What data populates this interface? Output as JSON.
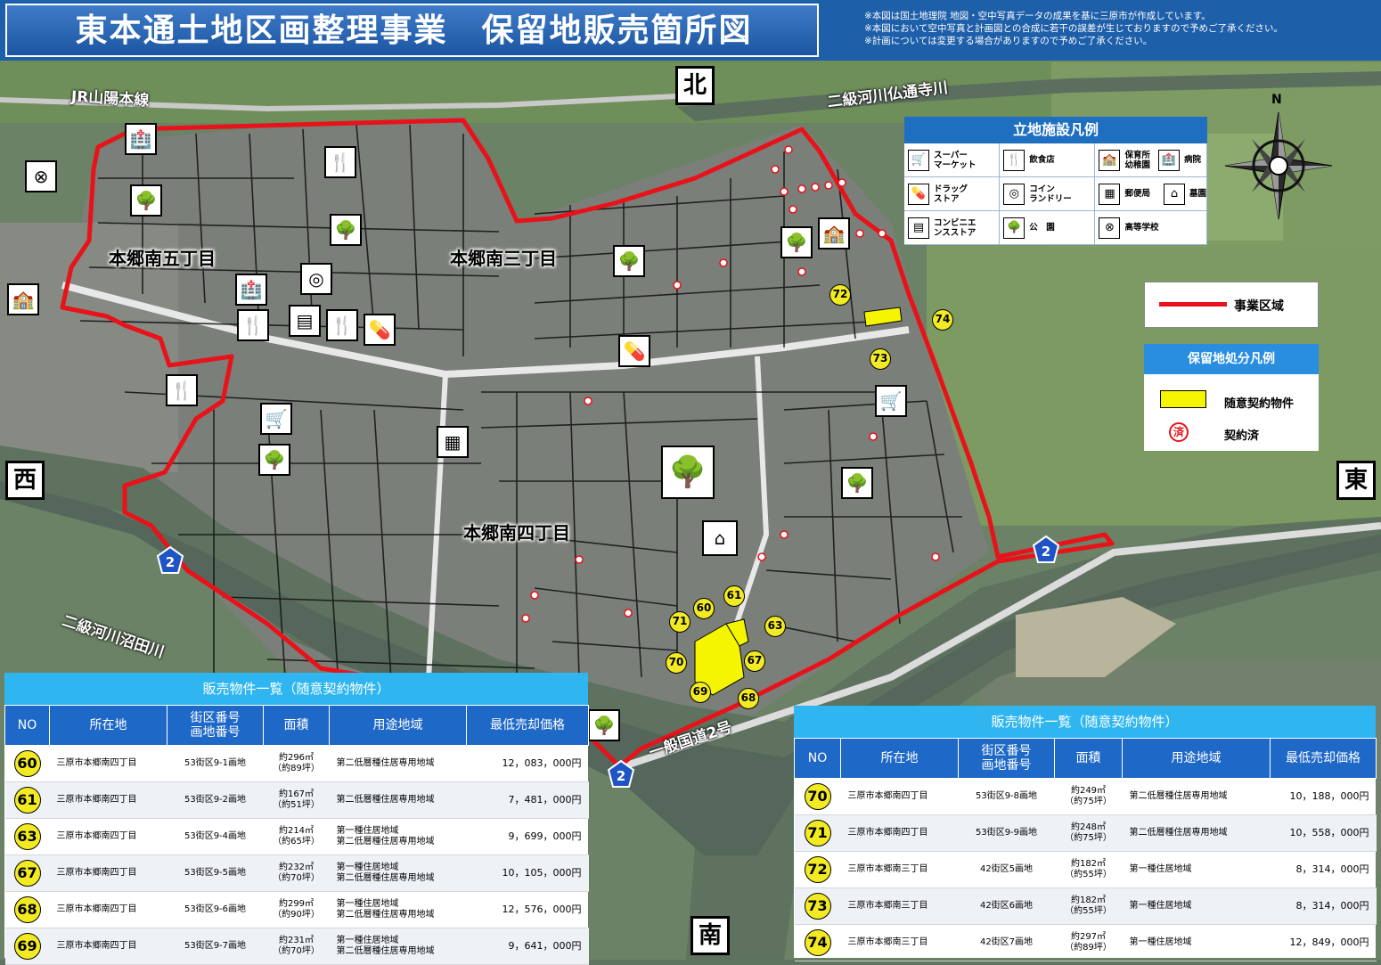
{
  "header": {
    "title": "東本通土地区画整理事業　保留地販売箇所図",
    "notes": [
      "※本図は国土地理院 地図・空中写真データの成果を基に三原市が作成しています。",
      "※本図において空中写真と計画図との合成に若干の誤差が生じておりますので予めご了承ください。",
      "※計画については変更する場合がありますので予めご了承ください。"
    ]
  },
  "directions": {
    "north": "北",
    "south": "南",
    "east": "東",
    "west": "西"
  },
  "compass": {
    "north_letter": "N"
  },
  "map_labels": {
    "districts": [
      "本郷南五丁目",
      "本郷南三丁目",
      "本郷南四丁目"
    ],
    "rail": "JR山陽本線",
    "river_north": "二級河川仏通寺川",
    "river_south": "二級河川沼田川",
    "highway": "一般国道2号",
    "route_number": "2"
  },
  "facility_icons": [
    "park-icon",
    "school-icon",
    "store-icon",
    "restaurant-icon",
    "laundry-icon",
    "hospital-icon",
    "drugstore-icon",
    "supermarket-icon",
    "convenience-icon",
    "cemetery-icon",
    "highschool-icon"
  ],
  "lots_on_map": [
    "72",
    "74",
    "73",
    "61",
    "60",
    "71",
    "63",
    "70",
    "67",
    "69",
    "68"
  ],
  "legend_facilities": {
    "title": "立地施設凡例",
    "items": [
      {
        "icon": "supermarket-icon",
        "label": "スーパー\nマーケット"
      },
      {
        "icon": "restaurant-icon",
        "label": "飲食店"
      },
      {
        "icon": "nursery-icon",
        "label": "保育所\n幼稚園"
      },
      {
        "icon": "hospital-icon",
        "label": "病院"
      },
      {
        "icon": "drugstore-icon",
        "label": "ドラッグ\nストア"
      },
      {
        "icon": "laundry-icon",
        "label": "コイン\nランドリー"
      },
      {
        "icon": "post-office-icon",
        "label": "郵便局"
      },
      {
        "icon": "cemetery-icon",
        "label": "墓園"
      },
      {
        "icon": "convenience-store-icon",
        "label": "コンビニエ\nンスストア"
      },
      {
        "icon": "park-icon",
        "label": "公　園"
      },
      {
        "icon": "highschool-icon",
        "label": "高等学校"
      }
    ]
  },
  "legend_area": {
    "label": "事業区域",
    "color": "#e8121a"
  },
  "legend_lots": {
    "title": "保留地処分凡例",
    "negotiated_label": "随意契約物件",
    "contracted_label": "契約済",
    "contracted_mark": "済",
    "negotiated_color": "#f5f500"
  },
  "table_columns": {
    "no": "NO",
    "location": "所在地",
    "block": "街区番号\n画地番号",
    "area": "面積",
    "zoning": "用途地域",
    "price": "最低売却価格"
  },
  "table_left": {
    "title": "販売物件一覧（随意契約物件）",
    "rows": [
      {
        "no": "60",
        "location": "三原市本郷南四丁目",
        "block": "53街区9-1画地",
        "area": "約296㎡\n（約89坪）",
        "zoning": "第二低層種住居専用地域",
        "price": "12，083，000円"
      },
      {
        "no": "61",
        "location": "三原市本郷南四丁目",
        "block": "53街区9-2画地",
        "area": "約167㎡\n（約51坪）",
        "zoning": "第二低層種住居専用地域",
        "price": "7，481，000円"
      },
      {
        "no": "63",
        "location": "三原市本郷南四丁目",
        "block": "53街区9-4画地",
        "area": "約214㎡\n（約65坪）",
        "zoning": "第一種住居地域\n第二低層種住居専用地域",
        "price": "9，699，000円"
      },
      {
        "no": "67",
        "location": "三原市本郷南四丁目",
        "block": "53街区9-5画地",
        "area": "約232㎡\n（約70坪）",
        "zoning": "第一種住居地域\n第二低層種住居専用地域",
        "price": "10，105，000円"
      },
      {
        "no": "68",
        "location": "三原市本郷南四丁目",
        "block": "53街区9-6画地",
        "area": "約299㎡\n（約90坪）",
        "zoning": "第一種住居地域\n第二低層種住居専用地域",
        "price": "12，576，000円"
      },
      {
        "no": "69",
        "location": "三原市本郷南四丁目",
        "block": "53街区9-7画地",
        "area": "約231㎡\n（約70坪）",
        "zoning": "第一種住居地域\n第二低層種住居専用地域",
        "price": "9，641，000円"
      }
    ]
  },
  "table_right": {
    "title": "販売物件一覧（随意契約物件）",
    "rows": [
      {
        "no": "70",
        "location": "三原市本郷南四丁目",
        "block": "53街区9-8画地",
        "area": "約249㎡\n（約75坪）",
        "zoning": "第二低層種住居専用地域",
        "price": "10，188，000円"
      },
      {
        "no": "71",
        "location": "三原市本郷南四丁目",
        "block": "53街区9-9画地",
        "area": "約248㎡\n（約75坪）",
        "zoning": "第二低層種住居専用地域",
        "price": "10，558，000円"
      },
      {
        "no": "72",
        "location": "三原市本郷南三丁目",
        "block": "42街区5画地",
        "area": "約182㎡\n（約55坪）",
        "zoning": "第一種住居地域",
        "price": "8，314，000円"
      },
      {
        "no": "73",
        "location": "三原市本郷南三丁目",
        "block": "42街区6画地",
        "area": "約182㎡\n（約55坪）",
        "zoning": "第一種住居地域",
        "price": "8，314，000円"
      },
      {
        "no": "74",
        "location": "三原市本郷南三丁目",
        "block": "42街区7画地",
        "area": "約297㎡\n（約89坪）",
        "zoning": "第一種住居地域",
        "price": "12，849，000円"
      }
    ]
  }
}
